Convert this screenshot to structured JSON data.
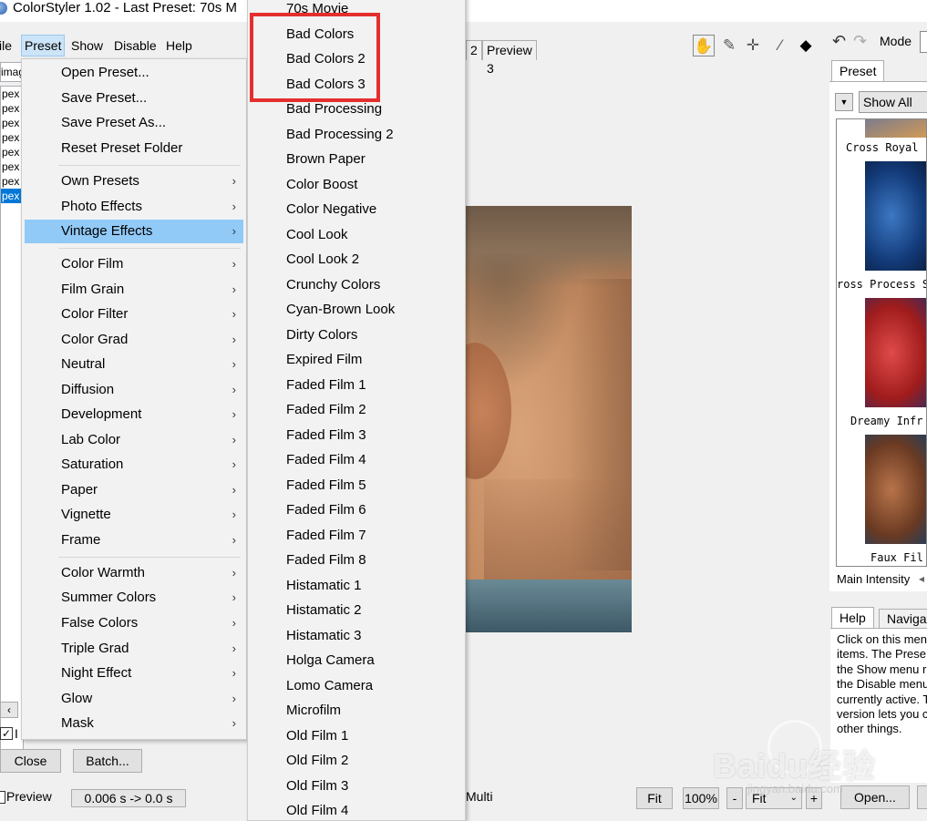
{
  "titlebar": {
    "title": "ColorStyler 1.02 - Last Preset: 70s M"
  },
  "menubar": {
    "file": "ile",
    "preset": "Preset",
    "show": "Show",
    "disable": "Disable",
    "help": "Help"
  },
  "left_panel": {
    "top_field": "imag",
    "rows": [
      "pex",
      "pex",
      "pex",
      "pex",
      "pex",
      "pex",
      "pex",
      "pex"
    ]
  },
  "preset_menu": {
    "group1": [
      "Open Preset...",
      "Save Preset...",
      "Save Preset As...",
      "Reset Preset Folder"
    ],
    "group2": [
      "Own Presets",
      "Photo Effects",
      "Vintage Effects"
    ],
    "group3": [
      "Color Film",
      "Film Grain",
      "Color Filter",
      "Color Grad",
      "Neutral",
      "Diffusion",
      "Development",
      "Lab Color",
      "Saturation",
      "Paper",
      "Vignette",
      "Frame"
    ],
    "group4": [
      "Color Warmth",
      "Summer Colors",
      "False Colors",
      "Triple Grad",
      "Night Effect",
      "Glow",
      "Mask"
    ],
    "highlighted": "Vintage Effects",
    "arrow": "›"
  },
  "vintage_submenu": {
    "items": [
      "70s Movie",
      "Bad Colors",
      "Bad Colors 2",
      "Bad Colors 3",
      "Bad Processing",
      "Bad Processing 2",
      "Brown Paper",
      "Color Boost",
      "Color Negative",
      "Cool Look",
      "Cool Look 2",
      "Crunchy Colors",
      "Cyan-Brown Look",
      "Dirty Colors",
      "Expired Film",
      "Faded Film 1",
      "Faded Film 2",
      "Faded Film 3",
      "Faded Film 4",
      "Faded Film 5",
      "Faded Film 6",
      "Faded Film 7",
      "Faded Film 8",
      "Histamatic 1",
      "Histamatic 2",
      "Histamatic 3",
      "Holga Camera",
      "Lomo Camera",
      "Microfilm",
      "Old Film 1",
      "Old Film 2",
      "Old Film 3",
      "Old Film 4"
    ]
  },
  "center": {
    "tabs": [
      "2",
      "Preview 3"
    ],
    "multi_label": "Multi"
  },
  "right_panel": {
    "mode_label": "Mode",
    "preset_tab": "Preset",
    "show_all": "Show All",
    "dropdown_glyph": "▼",
    "thumb_labels": [
      "Cross Royal",
      "ross Process S",
      "Dreamy Infr",
      "Faux Fil"
    ],
    "main_intensity": "Main Intensity",
    "help_tab": "Help",
    "navigator_tab": "Navigat",
    "help_lines": [
      "Click on this men",
      "items. The Prese",
      "the Show menu r",
      "the Disable menu",
      "currently active. T",
      "version lets you c",
      "other things."
    ]
  },
  "bottom": {
    "close": "Close",
    "batch": "Batch...",
    "preview_label": "Preview",
    "timing": "0.006 s -> 0.0 s",
    "fit_button": "Fit",
    "zoom": "100%",
    "minus": "-",
    "fit_select": "Fit",
    "plus": "+",
    "open": "Open...",
    "check_i": "I"
  },
  "watermark": {
    "text": "Baidu经验",
    "url": "jingyan.baidu.com"
  },
  "colors": {
    "highlight": "#91c9f7",
    "red_box": "#e52e2e",
    "selection": "#0078d7"
  }
}
